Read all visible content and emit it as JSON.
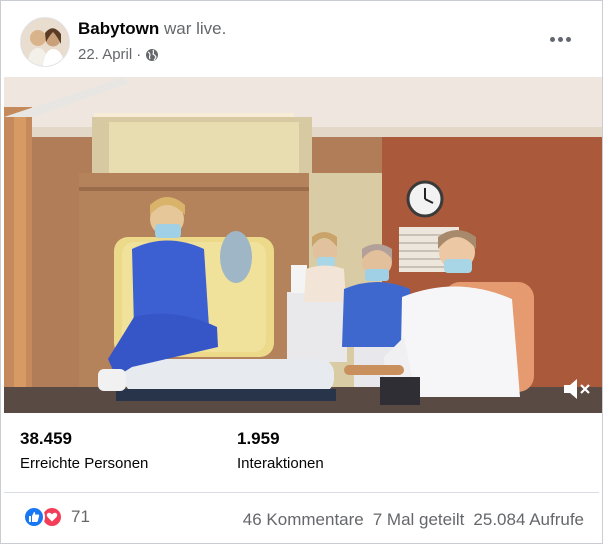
{
  "post": {
    "page_name": "Babytown",
    "status_text": "war live.",
    "date": "22. April",
    "privacy_icon": "globe-icon",
    "more_icon": "more-options-icon"
  },
  "video": {
    "control_icon": "speaker-muted-icon"
  },
  "stats": {
    "reached_value": "38.459",
    "reached_label": "Erreichte Personen",
    "interactions_value": "1.959",
    "interactions_label": "Interaktionen"
  },
  "footer": {
    "reactions_count": "71",
    "reaction_icons": [
      "like-icon",
      "love-icon"
    ],
    "comments": "46 Kommentare",
    "shares": "7 Mal geteilt",
    "views": "25.084 Aufrufe"
  },
  "colors": {
    "like_blue": "#1877f2",
    "love_red": "#f33e58",
    "secondary_text": "#65676b"
  }
}
